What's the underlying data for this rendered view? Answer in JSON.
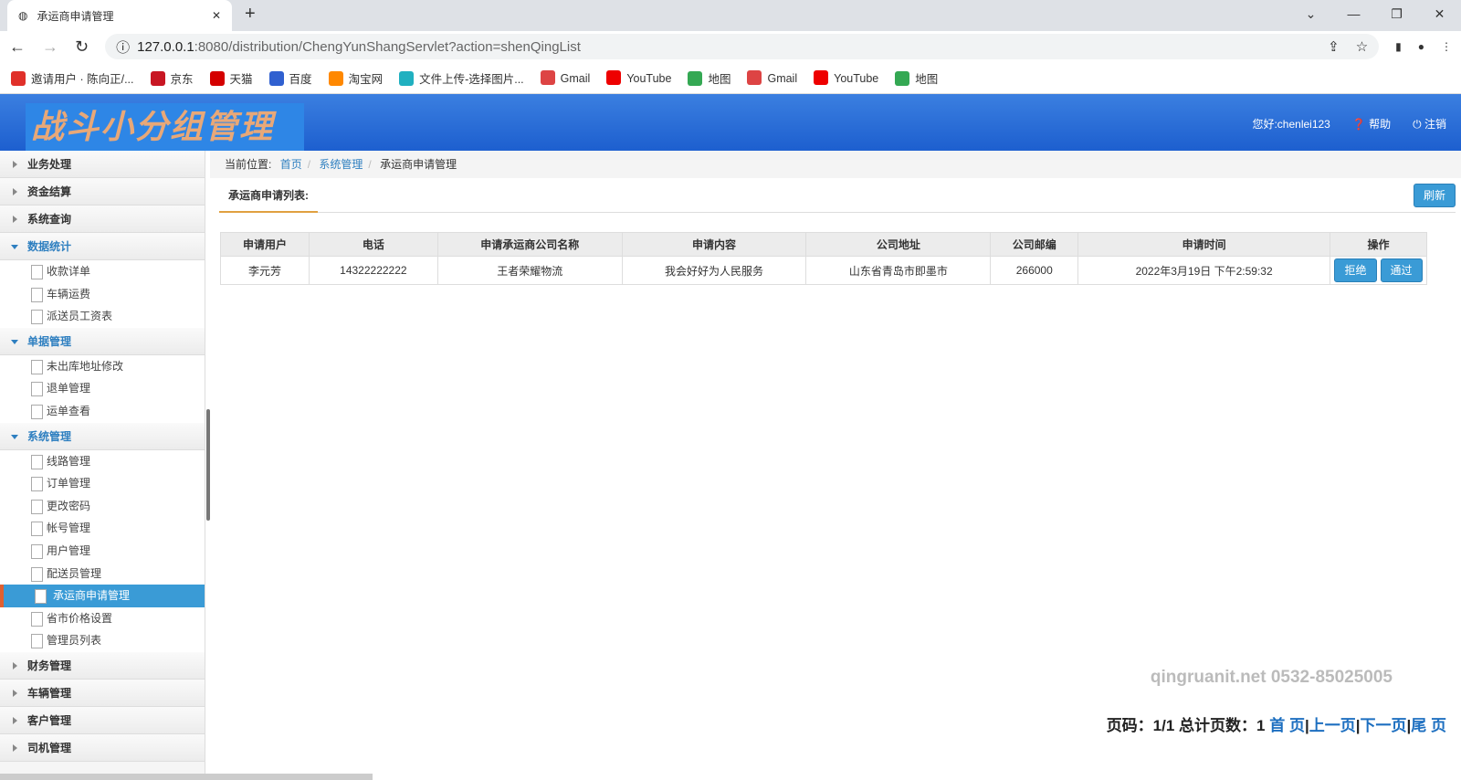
{
  "browser": {
    "tab_title": "承运商申请管理",
    "url_host": "127.0.0.1",
    "url_rest": ":8080/distribution/ChengYunShangServlet?action=shenQingList",
    "bookmarks": [
      {
        "label": "邀请用户 · 陈向正/...",
        "color": "#e0302a"
      },
      {
        "label": "京东",
        "color": "#c81623"
      },
      {
        "label": "天猫",
        "color": "#d40000"
      },
      {
        "label": "百度",
        "color": "#3060d0"
      },
      {
        "label": "淘宝网",
        "color": "#ff8800"
      },
      {
        "label": "文件上传-选择图片...",
        "color": "#20b0c0"
      },
      {
        "label": "Gmail",
        "color": "#d44"
      },
      {
        "label": "YouTube",
        "color": "#e00"
      },
      {
        "label": "地图",
        "color": "#34a853"
      },
      {
        "label": "Gmail",
        "color": "#d44"
      },
      {
        "label": "YouTube",
        "color": "#e00"
      },
      {
        "label": "地图",
        "color": "#34a853"
      }
    ]
  },
  "header": {
    "logo": "战斗小分组管理系统",
    "greeting": "您好:chenlei123",
    "help": "帮助",
    "logout": "注销"
  },
  "sidebar": [
    {
      "label": "业务处理",
      "open": false
    },
    {
      "label": "资金结算",
      "open": false
    },
    {
      "label": "系统查询",
      "open": false
    },
    {
      "label": "数据统计",
      "open": true,
      "items": [
        "收款详单",
        "车辆运费",
        "派送员工资表"
      ]
    },
    {
      "label": "单据管理",
      "open": true,
      "items": [
        "未出库地址修改",
        "退单管理",
        "运单查看"
      ]
    },
    {
      "label": "系统管理",
      "open": true,
      "items": [
        "线路管理",
        "订单管理",
        "更改密码",
        "帐号管理",
        "用户管理",
        "配送员管理",
        "承运商申请管理",
        "省市价格设置",
        "管理员列表"
      ],
      "active": "承运商申请管理"
    },
    {
      "label": "财务管理",
      "open": false
    },
    {
      "label": "车辆管理",
      "open": false
    },
    {
      "label": "客户管理",
      "open": false
    },
    {
      "label": "司机管理",
      "open": false
    }
  ],
  "breadcrumb": {
    "label": "当前位置:",
    "items": [
      "首页",
      "系统管理",
      "承运商申请管理"
    ]
  },
  "list": {
    "title": "承运商申请列表:",
    "refresh": "刷新",
    "columns": [
      "申请用户",
      "电话",
      "申请承运商公司名称",
      "申请内容",
      "公司地址",
      "公司邮编",
      "申请时间",
      "操作"
    ],
    "rows": [
      {
        "cells": [
          "李元芳",
          "14322222222",
          "王者荣耀物流",
          "我会好好为人民服务",
          "山东省青岛市即墨市",
          "266000",
          "2022年3月19日 下午2:59:32"
        ],
        "reject": "拒绝",
        "approve": "通过"
      }
    ]
  },
  "watermark": "qingruanit.net 0532-85025005",
  "pager": {
    "text": "页码：1/1 总计页数：1",
    "first": "首 页",
    "prev": "上一页",
    "next": "下一页",
    "last": "尾 页"
  }
}
